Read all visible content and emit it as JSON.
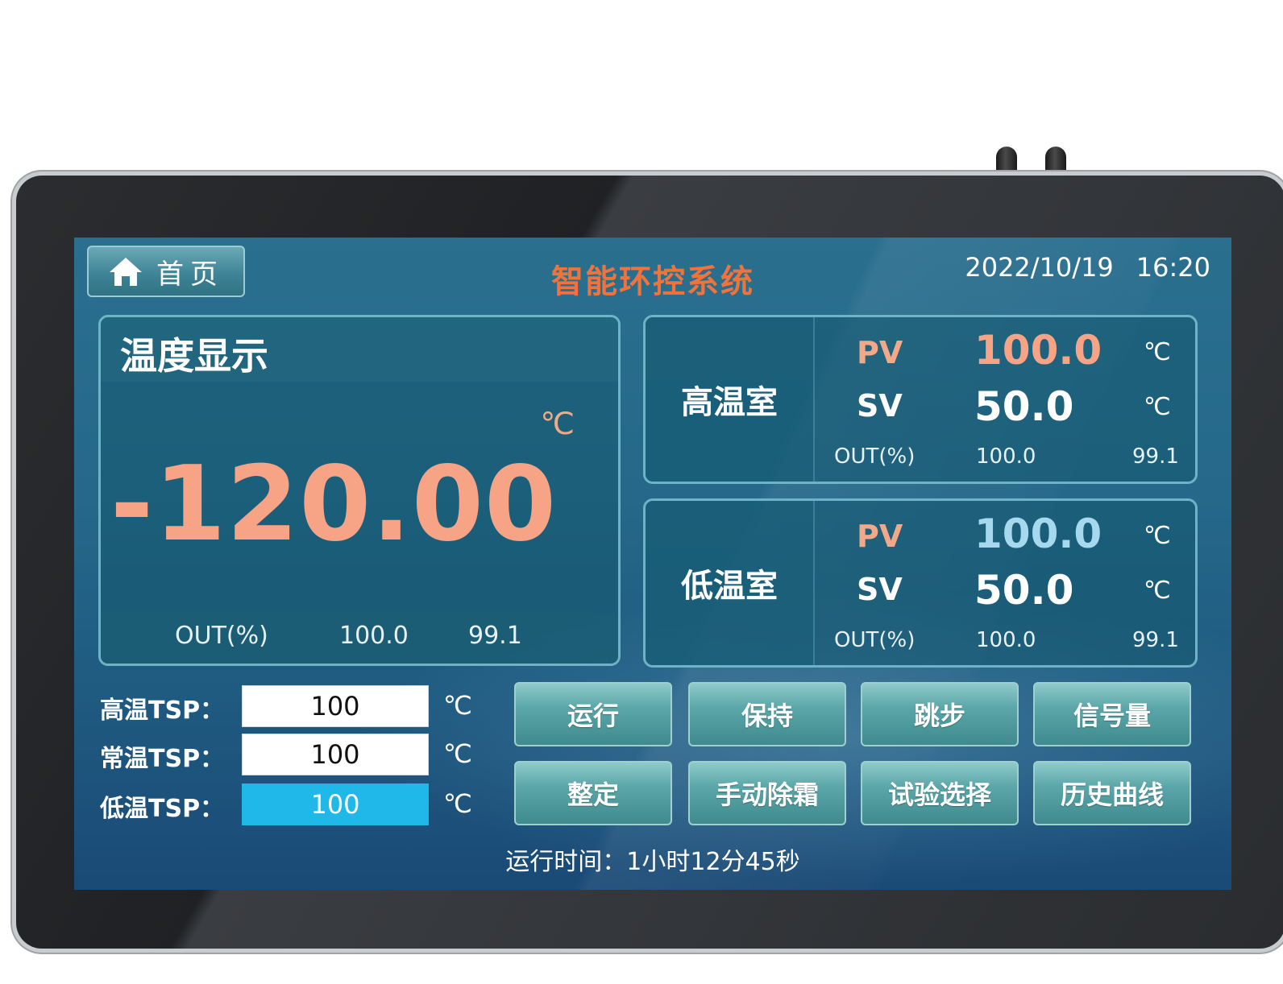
{
  "header": {
    "home_label": "首页",
    "title": "智能环控系统",
    "date": "2022/10/19",
    "time": "16:20"
  },
  "temperature_display": {
    "title": "温度显示",
    "unit": "℃",
    "value": "-120.00",
    "out_label": "OUT(%)",
    "out_value_1": "100.0",
    "out_value_2": "99.1"
  },
  "rooms": [
    {
      "name": "高温室",
      "pv_label": "PV",
      "pv_value": "100.0",
      "sv_label": "SV",
      "sv_value": "50.0",
      "unit": "℃",
      "out_label": "OUT(%)",
      "out_value_1": "100.0",
      "out_value_2": "99.1"
    },
    {
      "name": "低温室",
      "pv_label": "PV",
      "pv_value": "100.0",
      "sv_label": "SV",
      "sv_value": "50.0",
      "unit": "℃",
      "out_label": "OUT(%)",
      "out_value_1": "100.0",
      "out_value_2": "99.1"
    }
  ],
  "tsp": [
    {
      "label": "高温TSP：",
      "value": "100",
      "unit": "℃"
    },
    {
      "label": "常温TSP：",
      "value": "100",
      "unit": "℃"
    },
    {
      "label": "低温TSP：",
      "value": "100",
      "unit": "℃"
    }
  ],
  "buttons": {
    "run": "运行",
    "hold": "保持",
    "skip": "跳步",
    "signal": "信号量",
    "tune": "整定",
    "defrost": "手动除霜",
    "test_select": "试验选择",
    "history": "历史曲线"
  },
  "runtime": "运行时间：1小时12分45秒",
  "colors": {
    "title": "#f0733c",
    "pv_high": "#f6a386",
    "pv_low": "#a6d8ee",
    "active_input": "#20b8e8",
    "panel_border": "#6fb3c6"
  },
  "icons": {
    "home": "home-icon"
  }
}
